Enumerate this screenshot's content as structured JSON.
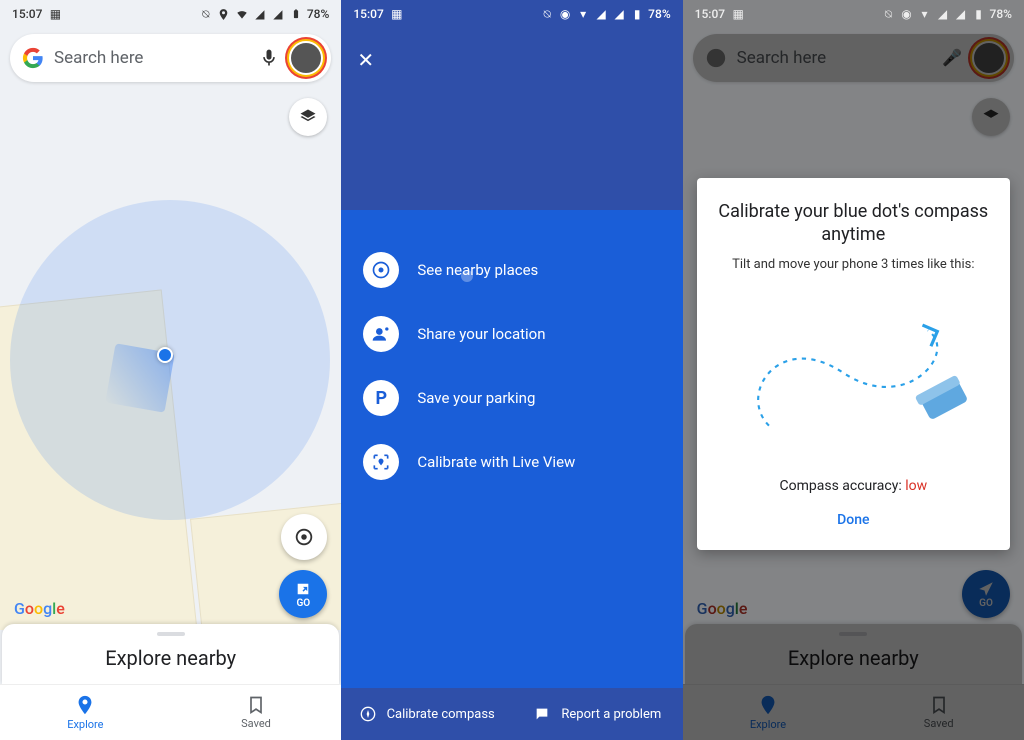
{
  "status": {
    "time": "15:07",
    "battery": "78%"
  },
  "search": {
    "placeholder": "Search here"
  },
  "go_button": "GO",
  "sheet": {
    "title": "Explore nearby"
  },
  "nav": {
    "explore": "Explore",
    "saved": "Saved"
  },
  "google_logo": "Google",
  "menu": {
    "items": [
      {
        "label": "See nearby places"
      },
      {
        "label": "Share your location"
      },
      {
        "label": "Save your parking"
      },
      {
        "label": "Calibrate with Live View"
      }
    ],
    "bottom": {
      "calibrate": "Calibrate compass",
      "report": "Report a problem"
    }
  },
  "dialog": {
    "title": "Calibrate your blue dot's compass anytime",
    "subtitle": "Tilt and move your phone 3 times like this:",
    "accuracy_label": "Compass accuracy:",
    "accuracy_value": "low",
    "done": "Done"
  }
}
